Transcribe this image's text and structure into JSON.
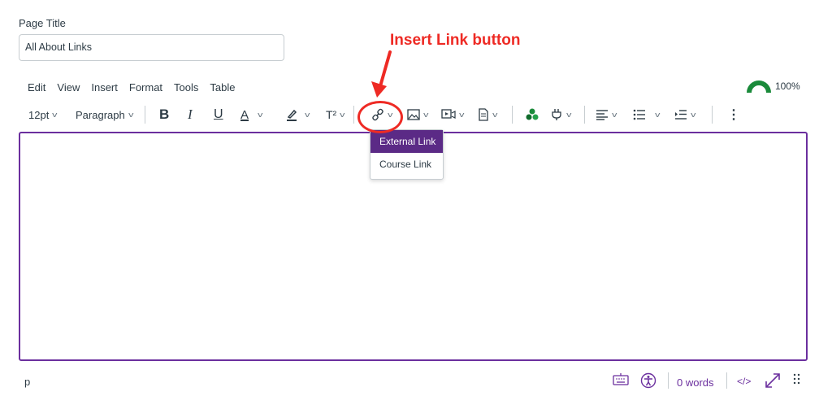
{
  "page_title": {
    "label": "Page Title",
    "value": "All About Links"
  },
  "annotation": {
    "text": "Insert Link button",
    "color": "#ee2a24"
  },
  "menubar": [
    "Edit",
    "View",
    "Insert",
    "Format",
    "Tools",
    "Table"
  ],
  "accessibility_score": {
    "percent_label": "100%",
    "color": "#1a8a3a"
  },
  "toolbar": {
    "font_size": "12pt",
    "block_format": "Paragraph",
    "bold": "B",
    "italic": "I",
    "underline": "U",
    "text_color": "A",
    "superscript": "T²"
  },
  "link_menu": {
    "items": [
      "External Link",
      "Course Link"
    ],
    "active_index": 0
  },
  "statusbar": {
    "element_path": "p",
    "word_count": "0 words",
    "html_toggle": "</>"
  },
  "colors": {
    "accent": "#6b2f9e",
    "menu_active": "#5b2a86"
  }
}
